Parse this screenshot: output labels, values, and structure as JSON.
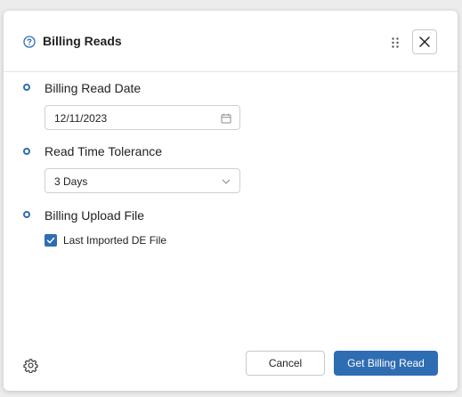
{
  "dialog": {
    "title": "Billing Reads",
    "sections": [
      {
        "label": "Billing Read Date",
        "value": "12/11/2023",
        "control": "date-picker"
      },
      {
        "label": "Read Time Tolerance",
        "value": "3 Days",
        "control": "select"
      },
      {
        "label": "Billing Upload File"
      }
    ],
    "checkbox": {
      "label": "Last Imported DE File",
      "checked": true
    }
  },
  "footer": {
    "cancel_label": "Cancel",
    "primary_label": "Get Billing Read"
  },
  "icons": {
    "help": "help-circle-icon",
    "drag": "drag-handle-icon",
    "close": "close-icon",
    "calendar": "calendar-icon",
    "chevron": "chevron-down-icon",
    "check": "checkmark-icon",
    "settings": "gear-icon"
  },
  "colors": {
    "accent": "#2f6db3",
    "border": "#cfcfcf",
    "text": "#222222"
  }
}
